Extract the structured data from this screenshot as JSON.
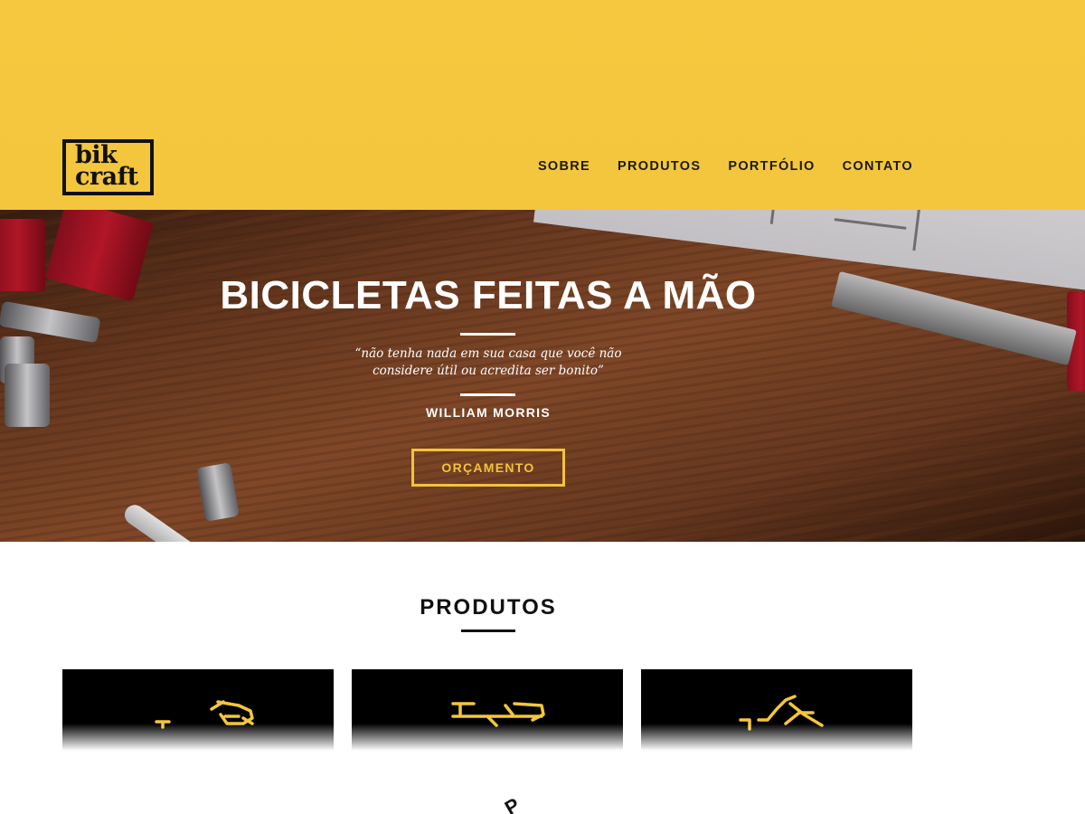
{
  "header": {
    "logo": {
      "line1": "bik",
      "line2": "craft"
    },
    "nav": [
      {
        "label": "SOBRE"
      },
      {
        "label": "PRODUTOS"
      },
      {
        "label": "PORTFÓLIO"
      },
      {
        "label": "CONTATO"
      }
    ]
  },
  "hero": {
    "title": "BICICLETAS FEITAS A MÃO",
    "quote": "“não tenha nada em sua casa que você não considere útil ou acredita ser bonito”",
    "author": "WILLIAM MORRIS",
    "button_label": "ORÇAMENTO"
  },
  "products": {
    "title": "PRODUTOS",
    "items": [
      {
        "icon": "bike-icon"
      },
      {
        "icon": "bike-icon"
      },
      {
        "icon": "bike-icon"
      }
    ]
  },
  "colors": {
    "accent": "#f4c63d",
    "dark": "#111111",
    "white": "#ffffff"
  }
}
